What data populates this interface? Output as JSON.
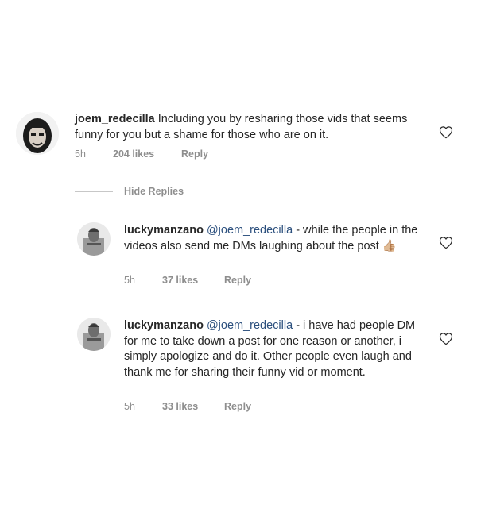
{
  "comments": [
    {
      "username": "joem_redecilla",
      "mention": "",
      "text": " Including you by resharing those vids that seems funny for you but a shame for those who are on it.",
      "time": "5h",
      "likes": "204 likes",
      "reply": "Reply"
    }
  ],
  "hide_replies_label": "Hide Replies",
  "replies": [
    {
      "username": "luckymanzano",
      "mention": "@joem_redecilla",
      "text": " - while the people in the videos also send me DMs laughing about the post 👍🏼",
      "time": "5h",
      "likes": "37 likes",
      "reply": "Reply"
    },
    {
      "username": "luckymanzano",
      "mention": "@joem_redecilla",
      "text": " - i have had people DM for me to take down a post for one reason or another, i simply apologize and do it. Other people even laugh and thank me for sharing their funny vid or moment.",
      "time": "5h",
      "likes": "33 likes",
      "reply": "Reply"
    }
  ],
  "icons": {
    "heart": "heart-outline-icon",
    "avatar": "avatar"
  },
  "colors": {
    "text": "#262626",
    "muted": "#8e8e8e",
    "mention": "#2b4f7d"
  }
}
